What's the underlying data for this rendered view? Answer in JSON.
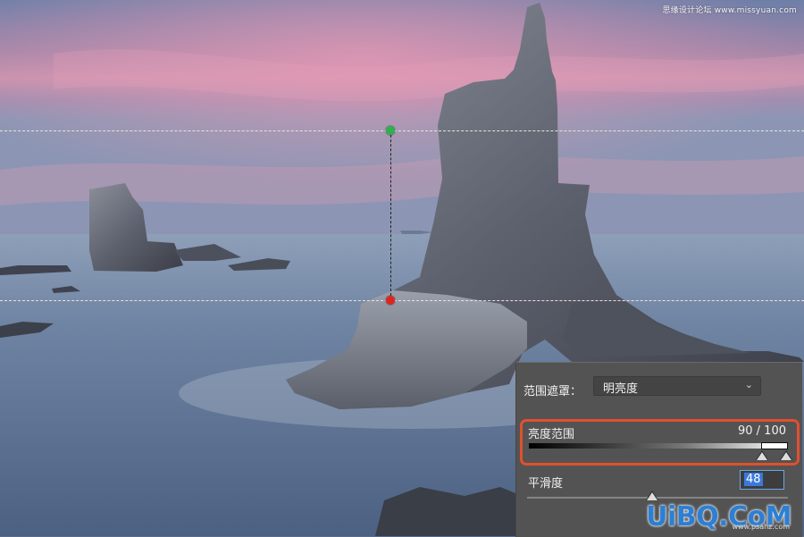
{
  "watermark_top": "思缘设计论坛 www.missyuan.com",
  "panel": {
    "range_mask_label": "范围遮罩：",
    "mode": {
      "selected": "明亮度",
      "icon": "chevron-down-icon"
    },
    "luminance": {
      "label": "亮度范围",
      "value": "90 / 100",
      "range_low": 90,
      "range_high": 100
    },
    "smoothness": {
      "label": "平滑度",
      "value": "48",
      "level_percent": 48
    }
  },
  "colors": {
    "highlight_border": "#e0502e",
    "green_marker": "#2bb24c",
    "red_marker": "#e2231a",
    "panel_bg": "#535353"
  },
  "watermark_bottom": {
    "main": "UiBQ.CoM",
    "url": "www.psahz.com"
  }
}
